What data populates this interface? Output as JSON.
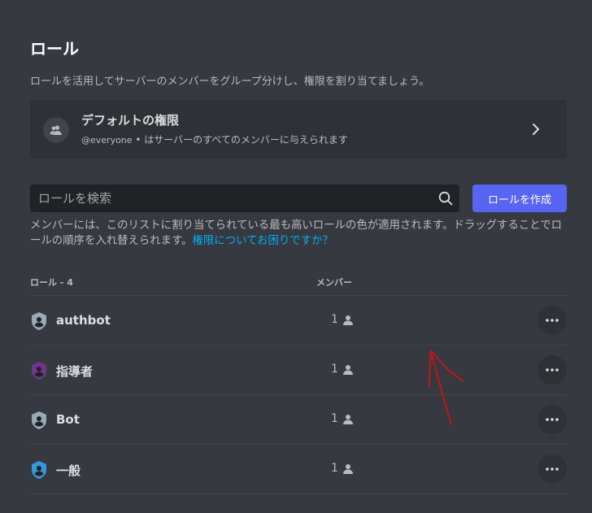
{
  "page": {
    "title": "ロール",
    "description": "ロールを活用してサーバーのメンバーをグループ分けし、権限を割り当てましょう。"
  },
  "default_permissions": {
    "title": "デフォルトの権限",
    "tag": "@everyone",
    "subtitle": " • はサーバーのすべてのメンバーに与えられます"
  },
  "search": {
    "placeholder": "ロールを検索"
  },
  "create_button": "ロールを作成",
  "help": {
    "text": "メンバーには、このリストに割り当てられている最も高いロールの色が適用されます。ドラッグすることでロールの順序を入れ替えられます。",
    "link": "権限についてお困りですか？"
  },
  "table": {
    "roles_header": "ロール - 4",
    "members_header": "メンバー"
  },
  "roles": [
    {
      "name": "authbot",
      "members": "1",
      "color": "#99aab5",
      "icon": "shield-icon"
    },
    {
      "name": "指導者",
      "members": "1",
      "color": "#71368a",
      "icon": "shield-icon"
    },
    {
      "name": "Bot",
      "members": "1",
      "color": "#99aab5",
      "icon": "shield-icon"
    },
    {
      "name": "一般",
      "members": "1",
      "color": "#3498db",
      "icon": "shield-icon"
    }
  ],
  "colors": {
    "background": "#36393f",
    "card": "#2f3136",
    "input": "#202225",
    "accent": "#5865f2",
    "link": "#00aff4",
    "annotation": "#c0161b"
  }
}
